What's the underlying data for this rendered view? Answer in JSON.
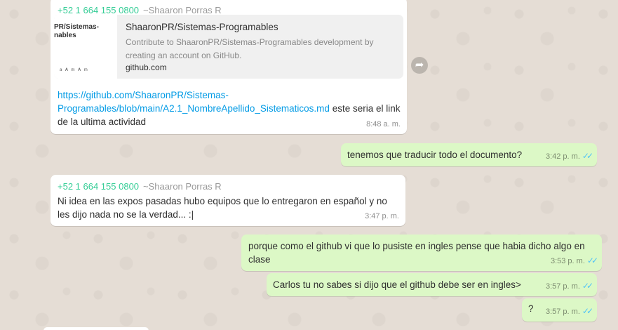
{
  "colors": {
    "incoming_bg": "#ffffff",
    "outgoing_bg": "#dcf8c6",
    "sender_phone": "#35cd96",
    "link": "#039be5",
    "read_ticks": "#4fc3f7"
  },
  "messages": [
    {
      "direction": "incoming",
      "sender_phone": "+52 1 664 155 0800",
      "sender_name": "~Shaaron Porras R",
      "preview": {
        "thumb_title": "PR/Sistemas-\nnables",
        "thumb_footer": "ᵃ ᴬ ᵐ ᴬ ᵐ",
        "title": "ShaaronPR/Sistemas-Programables",
        "description": "Contribute to ShaaronPR/Sistemas-Programables development by creating an account on GitHub.",
        "domain": "github.com"
      },
      "link": "https://github.com/ShaaronPR/Sistemas-Programables/blob/main/A2.1_NombreApellido_Sistematicos.md",
      "link_line1": "https://github.com/ShaaronPR/Sistemas-",
      "link_line2": "Programables/blob/main/A2.1_NombreApellido_Sistematicos.md",
      "text_after_link": " este seria el link de la ultima actividad",
      "time": "8:48 a. m.",
      "forward_icon": "forward-arrow-icon"
    },
    {
      "direction": "outgoing",
      "text": "tenemos que traducir todo el documento?",
      "time": "3:42 p. m.",
      "status_icon": "double-check-icon"
    },
    {
      "direction": "incoming",
      "sender_phone": "+52 1 664 155 0800",
      "sender_name": "~Shaaron Porras R",
      "text": "Ni idea en las expos pasadas hubo equipos que lo entregaron en español y no les dijo nada no se la verdad... :|",
      "time": "3:47 p. m."
    },
    {
      "direction": "outgoing",
      "text": "porque como el github vi que lo pusiste en ingles pense que habia dicho algo en clase",
      "time": "3:53 p. m.",
      "status_icon": "double-check-icon"
    },
    {
      "direction": "outgoing",
      "text": "Carlos tu no sabes si dijo que el github debe ser en ingles>",
      "time": "3:57 p. m.",
      "status_icon": "double-check-icon"
    },
    {
      "direction": "outgoing",
      "text": "?",
      "time": "3:57 p. m.",
      "status_icon": "double-check-icon"
    }
  ]
}
